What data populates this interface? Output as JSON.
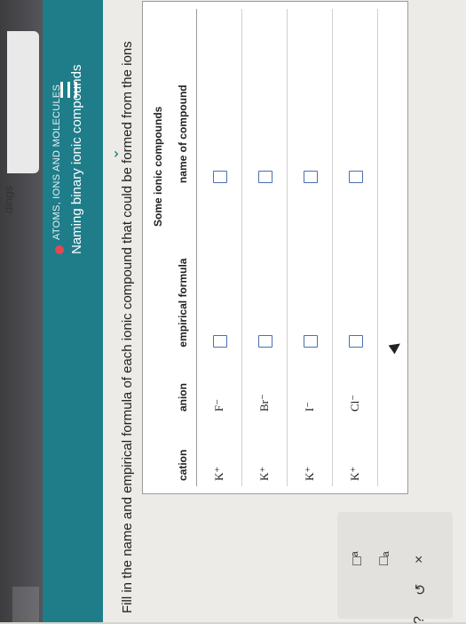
{
  "sidebar": {
    "label": "dings"
  },
  "header": {
    "section": "ATOMS, IONS AND MOLECULES",
    "title": "Naming binary ionic compounds"
  },
  "instruction": "Fill in the name and empirical formula of each ionic compound that could be formed from the ions",
  "table": {
    "caption": "Some ionic compounds",
    "headers": [
      "cation",
      "anion",
      "empirical formula",
      "name of compound"
    ],
    "rows": [
      {
        "cation": "K⁺",
        "anion": "F⁻"
      },
      {
        "cation": "K⁺",
        "anion": "Br⁻"
      },
      {
        "cation": "K⁺",
        "anion": "I⁻"
      },
      {
        "cation": "K⁺",
        "anion": "Cl⁻"
      }
    ]
  },
  "tools": {
    "superscript": "□ᵃ",
    "subscript": "□ₐ",
    "clear": "×",
    "undo": "↺",
    "help": "?"
  },
  "colors": {
    "header": "#1f7d8a",
    "status_dot": "#e5484d",
    "answer_box": "#4a6fb0"
  },
  "icons": [
    "menu-icon",
    "chevron-down-icon",
    "superscript-icon",
    "subscript-icon",
    "clear-icon",
    "undo-icon",
    "help-icon"
  ]
}
